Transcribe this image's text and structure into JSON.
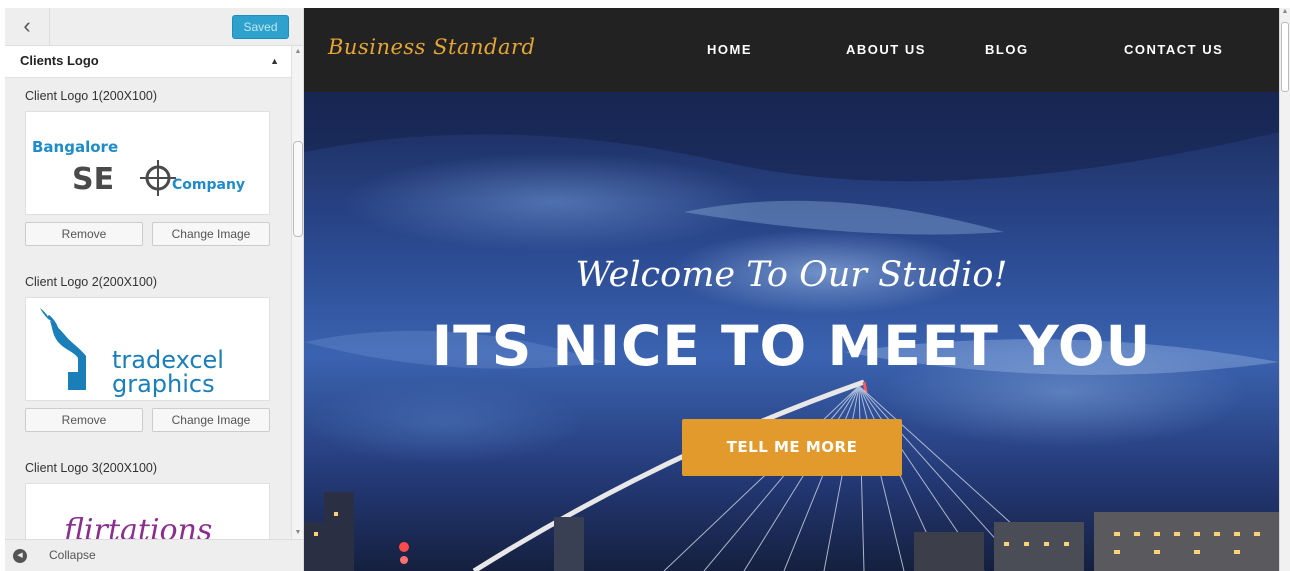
{
  "customizer": {
    "back_glyph": "‹",
    "saved_label": "Saved",
    "section_title": "Clients Logo",
    "section_toggle_glyph": "▲",
    "logos": [
      {
        "label": "Client Logo 1(200X100)",
        "image_name": "Bangalore SEO Company logo",
        "remove_label": "Remove",
        "change_label": "Change Image"
      },
      {
        "label": "Client Logo 2(200X100)",
        "image_name": "tradexcel graphics logo",
        "remove_label": "Remove",
        "change_label": "Change Image"
      },
      {
        "label": "Client Logo 3(200X100)",
        "image_name": "Flirtations logo"
      }
    ],
    "collapse_label": "Collapse",
    "colors": {
      "saved_button": "#2ea2cc",
      "sidebar_bg": "#eeeeee"
    }
  },
  "site": {
    "brand": "Business Standard",
    "nav": [
      "HOME",
      "ABOUT US",
      "BLOG",
      "CONTACT US"
    ],
    "hero": {
      "subtitle": "Welcome To Our Studio!",
      "title": "ITS NICE TO MEET YOU",
      "cta_label": "TELL ME MORE"
    },
    "colors": {
      "header_bg": "#222222",
      "brand": "#e6a534",
      "cta": "#e39a2d"
    }
  },
  "logo_text": {
    "seo_line1": "Bangalore",
    "seo_se": "SE",
    "seo_company": "Company",
    "trade_line1": "tradexcel",
    "trade_line2": "graphics",
    "flirt": "flirtations"
  }
}
